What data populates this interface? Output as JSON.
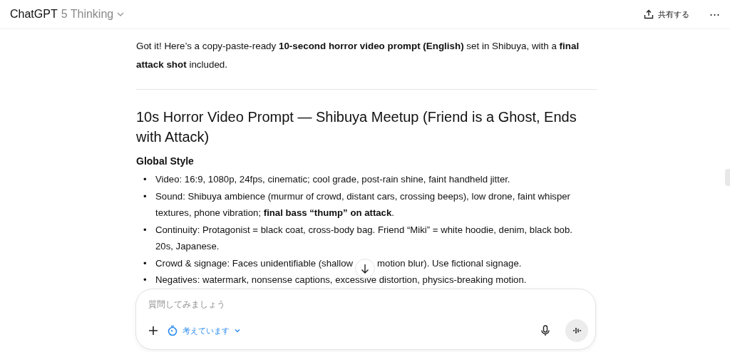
{
  "header": {
    "app_name": "ChatGPT",
    "model": "5 Thinking",
    "share_label": "共有する",
    "more_label": "⋯"
  },
  "message": {
    "intro": "Got it! Here’s a copy-paste-ready **10-second horror video prompt (English)** set in Shibuya, with a **final attack shot** included.",
    "heading": "10s Horror Video Prompt — Shibuya Meetup (Friend is a Ghost, Ends with Attack)",
    "subheading": "Global Style",
    "bullets": [
      {
        "marker": "•",
        "text": "Video: 16:9, 1080p, 24fps, cinematic; cool grade, post-rain shine, faint handheld jitter."
      },
      {
        "marker": "•",
        "text": "Sound: Shibuya ambience (murmur of crowd, distant cars, crossing beeps), low drone, faint whisper textures, phone vibration; **final bass “thump” on attack**."
      },
      {
        "marker": "•",
        "text": "Continuity: Protagonist = black coat, cross-body bag. Friend “Miki” = white hoodie, denim, black bob. 20s, Japanese."
      },
      {
        "marker": "•",
        "kind": "covered",
        "text": "Crowd & signage: Faces unidentifiable (shallow",
        "text_after": "motion blur). Use fictional signage."
      },
      {
        "marker": "•",
        "text": "Negatives: watermark, nonsense captions, excessive distortion, physics-breaking motion."
      }
    ]
  },
  "composer": {
    "placeholder": "質問してみましょう",
    "mode_label": "考えています"
  }
}
